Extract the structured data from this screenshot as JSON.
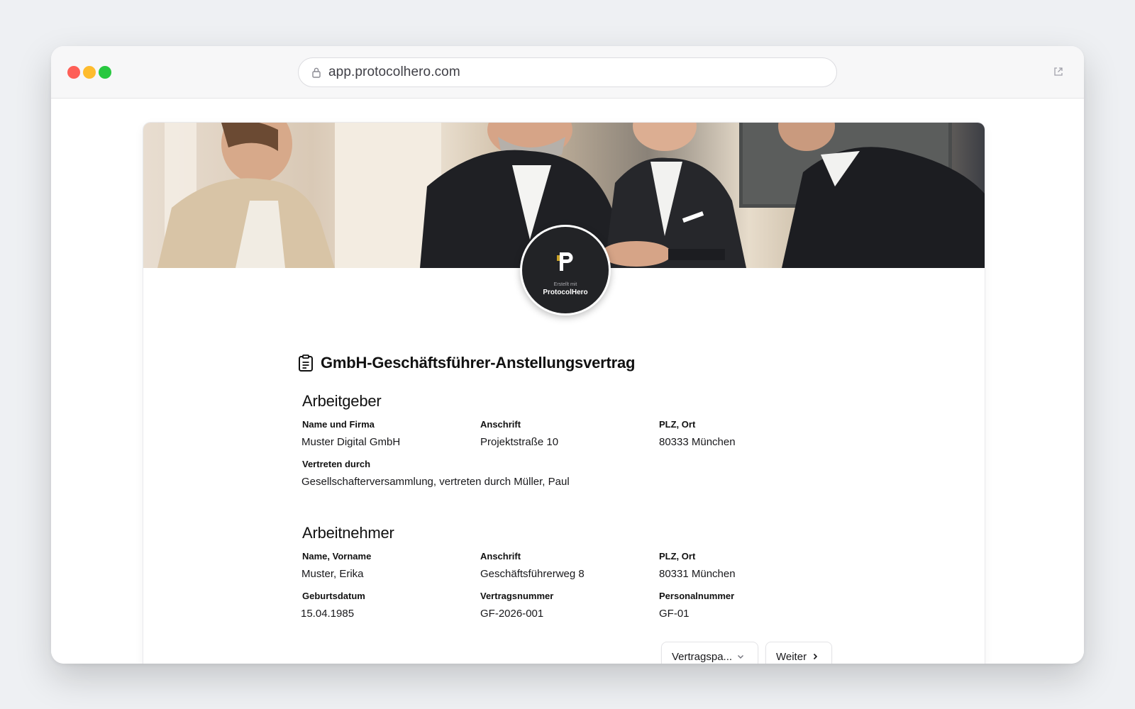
{
  "browser": {
    "url": "app.protocolhero.com",
    "icons": [
      "lock-icon",
      "external-link-icon"
    ]
  },
  "logo": {
    "small_text": "Erstellt mit",
    "name": "ProtocolHero"
  },
  "document": {
    "title": "GmbH-Geschäftsführer-Anstellungsvertrag",
    "icon": "clipboard-icon"
  },
  "employer": {
    "heading": "Arbeitgeber",
    "name_label": "Name und Firma",
    "name_value": "Muster Digital GmbH",
    "address_label": "Anschrift",
    "address_value": "Projektstraße 10",
    "city_label": "PLZ, Ort",
    "city_value": "80333 München",
    "represented_label": "Vertreten durch",
    "represented_value": "Gesellschafterversammlung, vertreten durch Müller, Paul"
  },
  "employee": {
    "heading": "Arbeitnehmer",
    "name_label": "Name, Vorname",
    "name_value": "Muster, Erika",
    "address_label": "Anschrift",
    "address_value": "Geschäftsführerweg 8",
    "city_label": "PLZ, Ort",
    "city_value": "80331 München",
    "birth_label": "Geburtsdatum",
    "birth_value": "15.04.1985",
    "contract_label": "Vertragsnummer",
    "contract_value": "GF-2026-001",
    "personnel_label": "Personalnummer",
    "personnel_value": "GF-01"
  },
  "buttons": {
    "contract_menu": "Vertragspa...",
    "next": "Weiter"
  }
}
